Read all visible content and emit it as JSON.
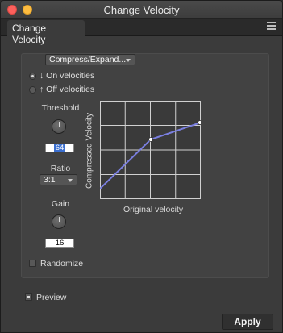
{
  "window": {
    "title": "Change Velocity"
  },
  "tab": {
    "label": "Change Velocity"
  },
  "mode": {
    "selected": "Compress/Expand..."
  },
  "apply_to": {
    "on_label": "↓ On velocities",
    "off_label": "↑ Off velocities",
    "selected": "on"
  },
  "threshold": {
    "label": "Threshold",
    "value": "64"
  },
  "ratio": {
    "label": "Ratio",
    "value": "3:1"
  },
  "gain": {
    "label": "Gain",
    "value": "16"
  },
  "graph": {
    "x_label": "Original velocity",
    "y_label": "Compressed Velocity"
  },
  "randomize": {
    "label": "Randomize",
    "checked": false
  },
  "preview": {
    "label": "Preview",
    "checked": true
  },
  "apply_button": {
    "label": "Apply"
  },
  "colors": {
    "curve": "#7a7fe0",
    "background": "#3b3b3b"
  }
}
